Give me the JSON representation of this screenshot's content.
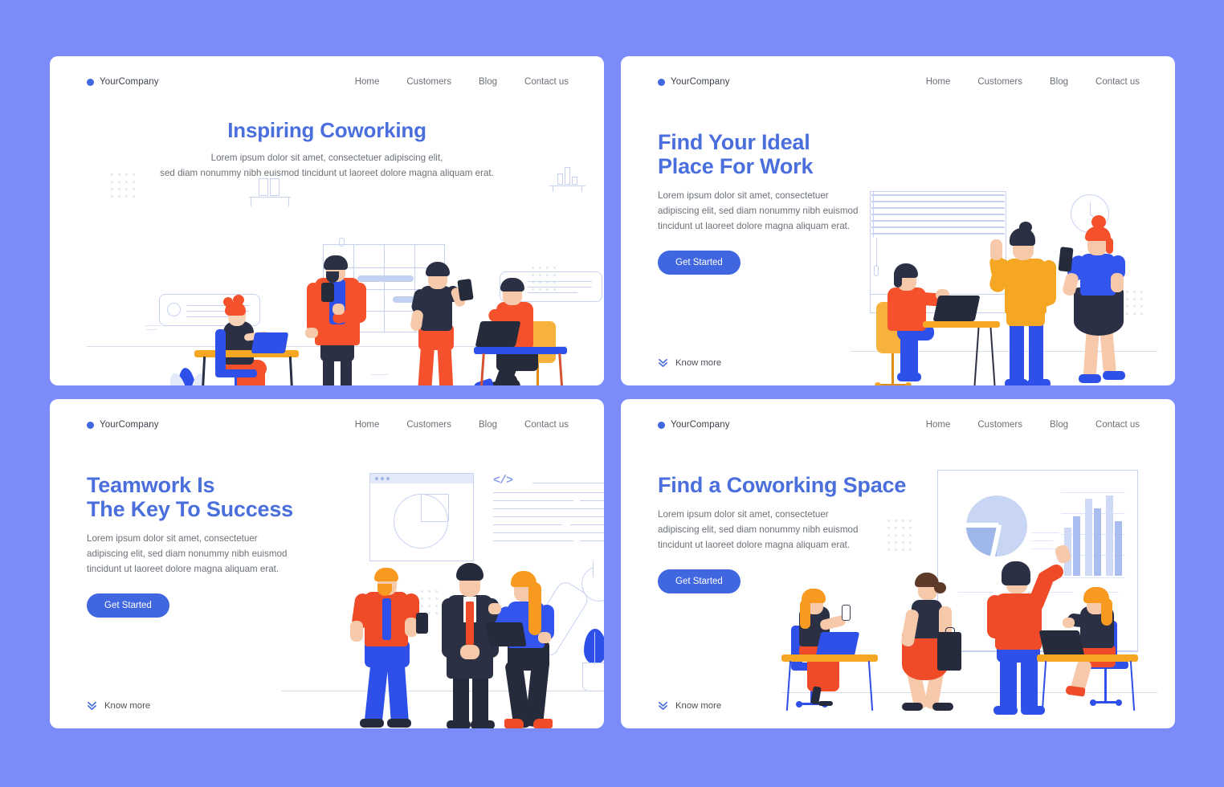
{
  "background_color": "#7b8cfa",
  "brand": {
    "accent_blue": "#4066e0",
    "heading_blue": "#4a6fdc",
    "body_gray": "#6b7078",
    "logo_label": "YourCompany",
    "logo_icon": "dot-icon"
  },
  "nav": {
    "links": [
      "Home",
      "Customers",
      "Blog",
      "Contact us"
    ]
  },
  "panels": [
    {
      "id": "panel-1",
      "layout": "centered",
      "heading": "Inspiring Coworking",
      "subtext_lines": [
        "Lorem ipsum dolor sit amet, consectetuer adipiscing elit,",
        "sed diam nonummy nibh euismod tincidunt ut laoreet dolore magna aliquam erat."
      ],
      "cta": null,
      "know_more": null,
      "illustration": "coworking-office-four-people"
    },
    {
      "id": "panel-2",
      "layout": "left",
      "heading_lines": [
        "Find Your Ideal",
        "Place For Work"
      ],
      "subtext_lines": [
        "Lorem ipsum dolor sit amet, consectetuer",
        "adipiscing elit, sed diam nonummy nibh euismod",
        "tincidunt ut laoreet dolore magna aliquam erat."
      ],
      "cta": "Get Started",
      "know_more": "Know more",
      "know_more_icon": "double-chevron-down-icon",
      "illustration": "office-window-clock-three-people"
    },
    {
      "id": "panel-3",
      "layout": "left",
      "heading_lines": [
        "Teamwork Is",
        "The Key To Success"
      ],
      "subtext_lines": [
        "Lorem ipsum dolor sit amet, consectetuer",
        "adipiscing elit, sed diam nonummy nibh euismod",
        "tincidunt ut laoreet dolore magna aliquam erat."
      ],
      "cta": "Get Started",
      "know_more": "Know more",
      "know_more_icon": "double-chevron-down-icon",
      "illustration": "team-three-people-browser-code-wrench"
    },
    {
      "id": "panel-4",
      "layout": "left",
      "heading_lines": [
        "Find a Coworking Space"
      ],
      "subtext_lines": [
        "Lorem ipsum dolor sit amet, consectetuer",
        "adipiscing elit, sed diam nonummy nibh euismod",
        "tincidunt ut laoreet dolore magna aliquam erat."
      ],
      "cta": "Get Started",
      "know_more": "Know more",
      "know_more_icon": "double-chevron-down-icon",
      "illustration": "presentation-charts-four-people"
    }
  ]
}
